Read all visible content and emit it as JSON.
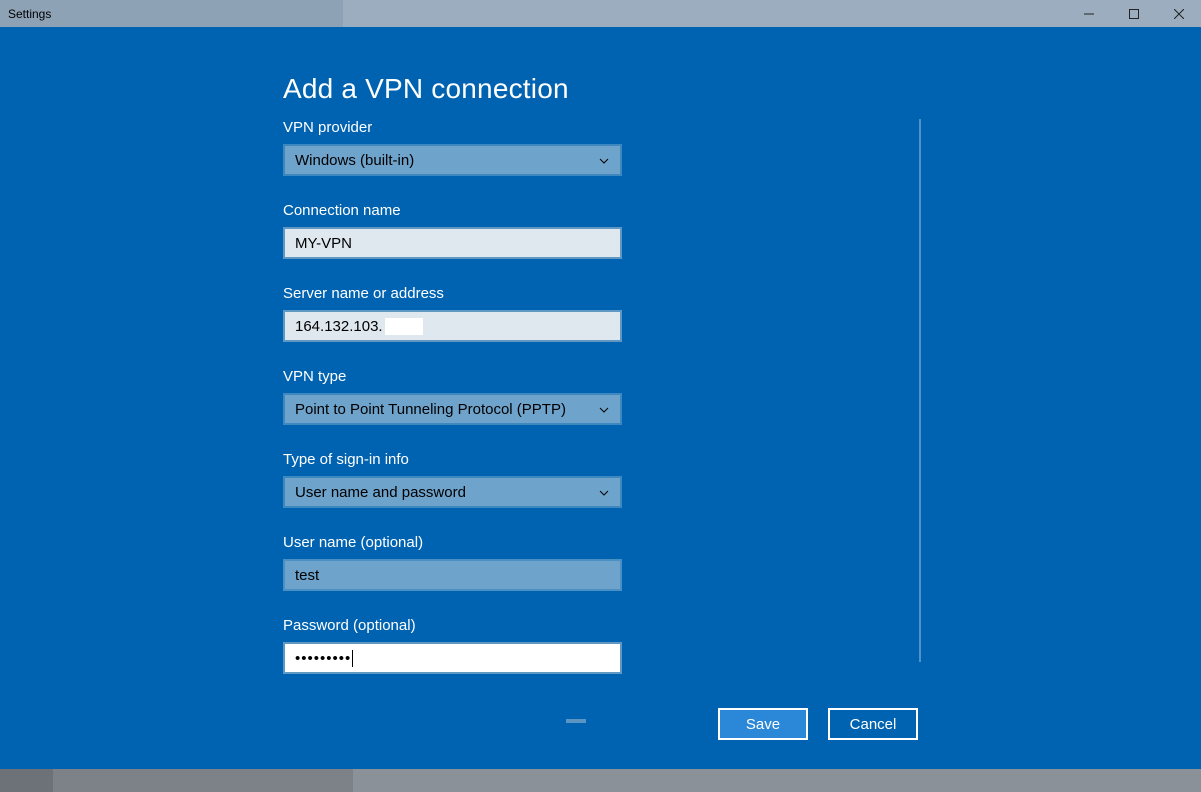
{
  "window": {
    "title": "Settings"
  },
  "page": {
    "title": "Add a VPN connection"
  },
  "form": {
    "provider": {
      "label": "VPN provider",
      "value": "Windows (built-in)"
    },
    "connection_name": {
      "label": "Connection name",
      "value": "MY-VPN"
    },
    "server": {
      "label": "Server name or address",
      "value": "164.132.103."
    },
    "vpn_type": {
      "label": "VPN type",
      "value": "Point to Point Tunneling Protocol (PPTP)"
    },
    "signin_type": {
      "label": "Type of sign-in info",
      "value": "User name and password"
    },
    "username": {
      "label": "User name (optional)",
      "value": "test"
    },
    "password": {
      "label": "Password (optional)",
      "value": "•••••••••"
    }
  },
  "buttons": {
    "save": "Save",
    "cancel": "Cancel"
  }
}
